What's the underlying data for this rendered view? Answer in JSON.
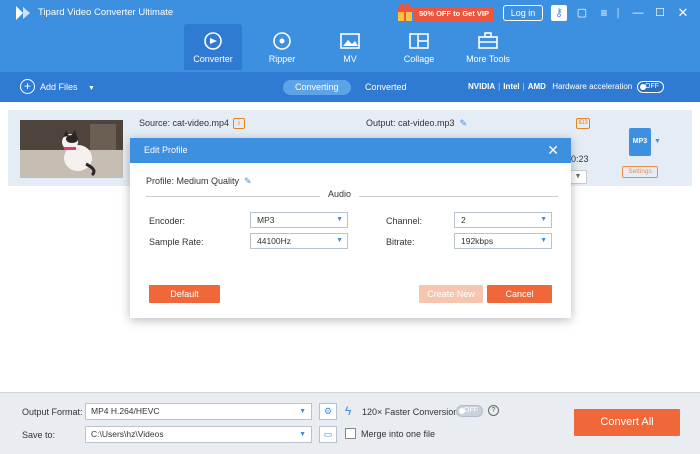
{
  "app": {
    "title": "Tipard Video Converter Ultimate",
    "vip_text": "50% OFF to Get VIP",
    "login_label": "Log in"
  },
  "nav": [
    {
      "label": "Converter",
      "icon": "converter-icon",
      "active": true
    },
    {
      "label": "Ripper",
      "icon": "ripper-icon",
      "active": false
    },
    {
      "label": "MV",
      "icon": "mv-icon",
      "active": false
    },
    {
      "label": "Collage",
      "icon": "collage-icon",
      "active": false
    },
    {
      "label": "More Tools",
      "icon": "toolbox-icon",
      "active": false
    }
  ],
  "toolbar": {
    "add_files": "Add Files",
    "tabs": [
      "Converting",
      "Converted"
    ],
    "hw": {
      "nvidia": "NVIDIA",
      "intel": "Intel",
      "amd": "AMD",
      "label": "Hardware acceleration",
      "toggle": "OFF"
    }
  },
  "file": {
    "source": "Source: cat-video.mp4",
    "output": "Output: cat-video.mp3",
    "duration": "0:23",
    "format": "MP3",
    "settings": "Settings",
    "id3": "ID3"
  },
  "modal": {
    "title": "Edit Profile",
    "profile": "Profile:  Medium Quality",
    "section": "Audio",
    "encoder": {
      "label": "Encoder:",
      "value": "MP3"
    },
    "sample_rate": {
      "label": "Sample Rate:",
      "value": "44100Hz"
    },
    "channel": {
      "label": "Channel:",
      "value": "2"
    },
    "bitrate": {
      "label": "Bitrate:",
      "value": "192kbps"
    },
    "default": "Default",
    "create_new": "Create New",
    "cancel": "Cancel"
  },
  "footer": {
    "output_format_label": "Output Format:",
    "output_format_value": "MP4 H.264/HEVC",
    "save_to_label": "Save to:",
    "save_to_value": "C:\\Users\\hz\\Videos",
    "faster": "120× Faster Conversion",
    "faster_toggle": "OFF",
    "merge": "Merge into one file",
    "convert_all": "Convert All"
  }
}
